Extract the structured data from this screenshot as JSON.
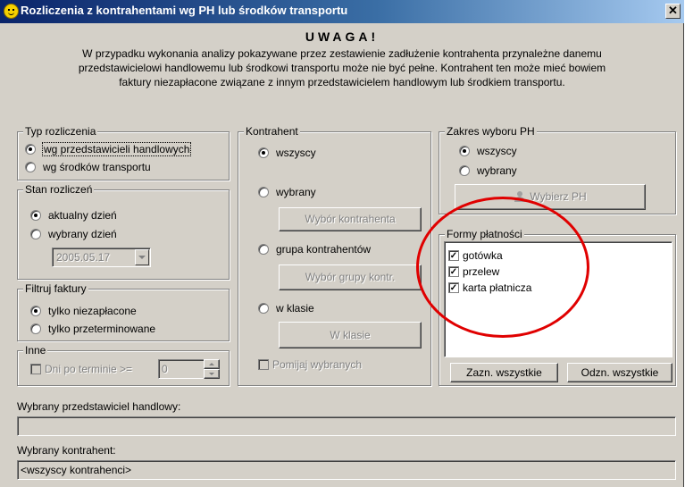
{
  "window": {
    "title": "Rozliczenia z kontrahentami wg PH lub środków transportu",
    "close_label": "✕"
  },
  "warning": {
    "heading": "UWAGA!",
    "line1": "W przypadku wykonania analizy pokazywane przez zestawienie zadłużenie kontrahenta przynależne danemu",
    "line2": "przedstawicielowi handlowemu lub środkowi transportu może nie być pełne. Kontrahent ten może mieć bowiem",
    "line3": "faktury niezapłacone związane z innym przedstawicielem handlowym lub środkiem transportu."
  },
  "typ": {
    "label": "Typ rozliczenia",
    "options": [
      "wg przedstawicieli handlowych",
      "wg środków transportu"
    ],
    "selected": 0
  },
  "stan": {
    "label": "Stan rozliczeń",
    "options": [
      "aktualny dzień",
      "wybrany dzień"
    ],
    "selected": 0,
    "date": "2005.05.17"
  },
  "filtr": {
    "label": "Filtruj faktury",
    "options": [
      "tylko niezapłacone",
      "tylko przeterminowane"
    ],
    "selected": 0
  },
  "inne": {
    "label": "Inne",
    "check_label": "Dni po terminie >=",
    "value": "0"
  },
  "kontrahent": {
    "label": "Kontrahent",
    "options": [
      "wszyscy",
      "wybrany",
      "grupa kontrahentów",
      "w klasie"
    ],
    "selected": 0,
    "btn_wybor": "Wybór kontrahenta",
    "btn_grupa": "Wybór grupy kontr.",
    "btn_klasie": "W klasie",
    "pomijaj": "Pomijaj wybranych"
  },
  "zakres": {
    "label": "Zakres wyboru PH",
    "options": [
      "wszyscy",
      "wybrany"
    ],
    "selected": 0,
    "btn": "Wybierz PH"
  },
  "formy": {
    "label": "Formy płatności",
    "items": [
      "gotówka",
      "przelew",
      "karta płatnicza"
    ],
    "btn_zazn": "Zazn. wszystkie",
    "btn_odzn": "Odzn. wszystkie"
  },
  "selected_ph": {
    "label": "Wybrany przedstawiciel handlowy:",
    "value": ""
  },
  "selected_k": {
    "label": "Wybrany kontrahent:",
    "value": "<wszyscy kontrahenci>"
  },
  "colors": {
    "title_start": "#0a246a",
    "title_end": "#a6caf0",
    "face": "#d4d0c8",
    "annotation": "#e00000"
  }
}
